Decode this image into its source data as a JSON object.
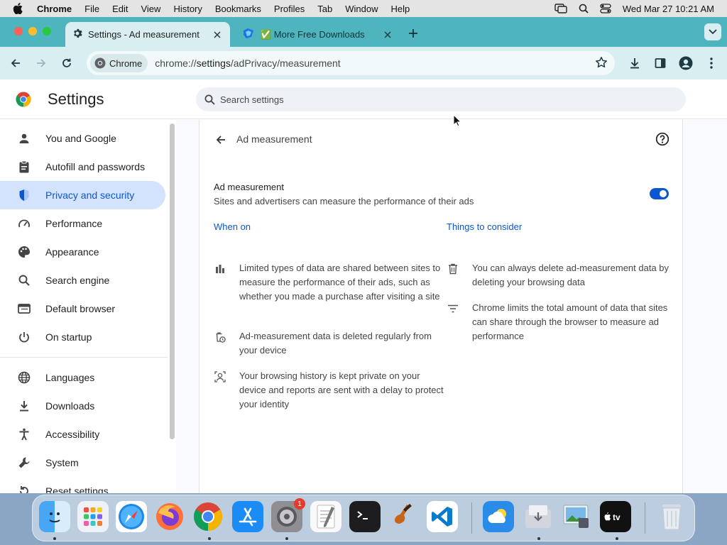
{
  "menubar": {
    "app_name": "Chrome",
    "items": [
      "File",
      "Edit",
      "View",
      "History",
      "Bookmarks",
      "Profiles",
      "Tab",
      "Window",
      "Help"
    ],
    "clock": "Wed Mar 27  10:21 AM"
  },
  "tabs": [
    {
      "title": "Settings - Ad measurement",
      "icon": "gear-icon"
    },
    {
      "title": "✅ More Free Downloads",
      "icon": "site-favicon"
    }
  ],
  "toolbar": {
    "chip_label": "Chrome",
    "url_prefix": "chrome://",
    "url_host": "settings",
    "url_path": "/adPrivacy/measurement"
  },
  "settings": {
    "title": "Settings",
    "search_placeholder": "Search settings"
  },
  "sidebar": {
    "items": [
      {
        "label": "You and Google",
        "icon": "person-icon"
      },
      {
        "label": "Autofill and passwords",
        "icon": "clipboard-icon"
      },
      {
        "label": "Privacy and security",
        "icon": "shield-icon",
        "active": true
      },
      {
        "label": "Performance",
        "icon": "speedometer-icon"
      },
      {
        "label": "Appearance",
        "icon": "palette-icon"
      },
      {
        "label": "Search engine",
        "icon": "search-icon"
      },
      {
        "label": "Default browser",
        "icon": "browser-icon"
      },
      {
        "label": "On startup",
        "icon": "power-icon"
      },
      {
        "label": "Languages",
        "icon": "globe-icon"
      },
      {
        "label": "Downloads",
        "icon": "download-icon"
      },
      {
        "label": "Accessibility",
        "icon": "accessibility-icon"
      },
      {
        "label": "System",
        "icon": "wrench-icon"
      },
      {
        "label": "Reset settings",
        "icon": "reset-icon"
      }
    ]
  },
  "page": {
    "subpage_title": "Ad measurement",
    "setting_title": "Ad measurement",
    "setting_description": "Sites and advertisers can measure the performance of their ads",
    "toggle_on": true,
    "when_on_heading": "When on",
    "consider_heading": "Things to consider",
    "when_on_points": [
      {
        "text": "Limited types of data are shared between sites to measure the performance of their ads, such as whether you made a purchase after visiting a site",
        "icon": "bar-chart-icon"
      },
      {
        "text": "Ad-measurement data is deleted regularly from your device",
        "icon": "timed-delete-icon"
      },
      {
        "text": "Your browsing history is kept private on your device and reports are sent with a delay to protect your identity",
        "icon": "private-person-icon"
      }
    ],
    "consider_points": [
      {
        "text": "You can always delete ad-measurement data by deleting your browsing data",
        "icon": "trash-icon"
      },
      {
        "text": "Chrome limits the total amount of data that sites can share through the browser to measure ad performance",
        "icon": "filter-lines-icon"
      }
    ]
  },
  "dock": {
    "apps": [
      "Finder",
      "Launchpad",
      "Safari",
      "Firefox",
      "Chrome",
      "App Store",
      "System Settings",
      "TextEdit",
      "Terminal",
      "GarageBand",
      "Visual Studio Code",
      "Weather",
      "Downloads",
      "Preview",
      "Apple TV",
      "Trash"
    ],
    "settings_badge": "1"
  }
}
